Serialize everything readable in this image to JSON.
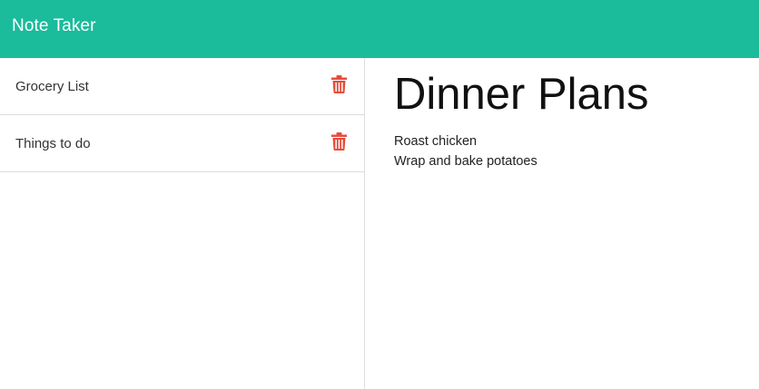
{
  "navbar": {
    "brand": "Note Taker"
  },
  "sidebar": {
    "notes": [
      {
        "title": "Grocery List",
        "delete_icon": "trash-icon"
      },
      {
        "title": "Things to do",
        "delete_icon": "trash-icon"
      }
    ]
  },
  "active_note": {
    "title": "Dinner Plans",
    "body_lines": [
      "Roast chicken",
      "Wrap and bake potatoes"
    ]
  },
  "colors": {
    "navbar_bg": "#1abc9c",
    "delete_icon": "#e74c3c"
  }
}
